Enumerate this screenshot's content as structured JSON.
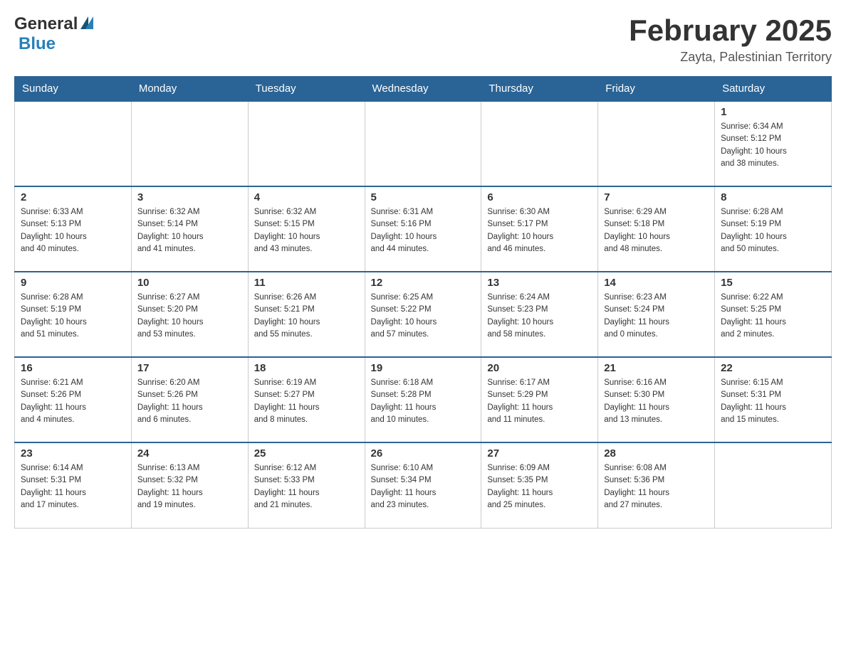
{
  "header": {
    "logo_general": "General",
    "logo_blue": "Blue",
    "month_year": "February 2025",
    "location": "Zayta, Palestinian Territory"
  },
  "days_of_week": [
    "Sunday",
    "Monday",
    "Tuesday",
    "Wednesday",
    "Thursday",
    "Friday",
    "Saturday"
  ],
  "weeks": [
    {
      "days": [
        {
          "number": "",
          "info": ""
        },
        {
          "number": "",
          "info": ""
        },
        {
          "number": "",
          "info": ""
        },
        {
          "number": "",
          "info": ""
        },
        {
          "number": "",
          "info": ""
        },
        {
          "number": "",
          "info": ""
        },
        {
          "number": "1",
          "info": "Sunrise: 6:34 AM\nSunset: 5:12 PM\nDaylight: 10 hours\nand 38 minutes."
        }
      ]
    },
    {
      "days": [
        {
          "number": "2",
          "info": "Sunrise: 6:33 AM\nSunset: 5:13 PM\nDaylight: 10 hours\nand 40 minutes."
        },
        {
          "number": "3",
          "info": "Sunrise: 6:32 AM\nSunset: 5:14 PM\nDaylight: 10 hours\nand 41 minutes."
        },
        {
          "number": "4",
          "info": "Sunrise: 6:32 AM\nSunset: 5:15 PM\nDaylight: 10 hours\nand 43 minutes."
        },
        {
          "number": "5",
          "info": "Sunrise: 6:31 AM\nSunset: 5:16 PM\nDaylight: 10 hours\nand 44 minutes."
        },
        {
          "number": "6",
          "info": "Sunrise: 6:30 AM\nSunset: 5:17 PM\nDaylight: 10 hours\nand 46 minutes."
        },
        {
          "number": "7",
          "info": "Sunrise: 6:29 AM\nSunset: 5:18 PM\nDaylight: 10 hours\nand 48 minutes."
        },
        {
          "number": "8",
          "info": "Sunrise: 6:28 AM\nSunset: 5:19 PM\nDaylight: 10 hours\nand 50 minutes."
        }
      ]
    },
    {
      "days": [
        {
          "number": "9",
          "info": "Sunrise: 6:28 AM\nSunset: 5:19 PM\nDaylight: 10 hours\nand 51 minutes."
        },
        {
          "number": "10",
          "info": "Sunrise: 6:27 AM\nSunset: 5:20 PM\nDaylight: 10 hours\nand 53 minutes."
        },
        {
          "number": "11",
          "info": "Sunrise: 6:26 AM\nSunset: 5:21 PM\nDaylight: 10 hours\nand 55 minutes."
        },
        {
          "number": "12",
          "info": "Sunrise: 6:25 AM\nSunset: 5:22 PM\nDaylight: 10 hours\nand 57 minutes."
        },
        {
          "number": "13",
          "info": "Sunrise: 6:24 AM\nSunset: 5:23 PM\nDaylight: 10 hours\nand 58 minutes."
        },
        {
          "number": "14",
          "info": "Sunrise: 6:23 AM\nSunset: 5:24 PM\nDaylight: 11 hours\nand 0 minutes."
        },
        {
          "number": "15",
          "info": "Sunrise: 6:22 AM\nSunset: 5:25 PM\nDaylight: 11 hours\nand 2 minutes."
        }
      ]
    },
    {
      "days": [
        {
          "number": "16",
          "info": "Sunrise: 6:21 AM\nSunset: 5:26 PM\nDaylight: 11 hours\nand 4 minutes."
        },
        {
          "number": "17",
          "info": "Sunrise: 6:20 AM\nSunset: 5:26 PM\nDaylight: 11 hours\nand 6 minutes."
        },
        {
          "number": "18",
          "info": "Sunrise: 6:19 AM\nSunset: 5:27 PM\nDaylight: 11 hours\nand 8 minutes."
        },
        {
          "number": "19",
          "info": "Sunrise: 6:18 AM\nSunset: 5:28 PM\nDaylight: 11 hours\nand 10 minutes."
        },
        {
          "number": "20",
          "info": "Sunrise: 6:17 AM\nSunset: 5:29 PM\nDaylight: 11 hours\nand 11 minutes."
        },
        {
          "number": "21",
          "info": "Sunrise: 6:16 AM\nSunset: 5:30 PM\nDaylight: 11 hours\nand 13 minutes."
        },
        {
          "number": "22",
          "info": "Sunrise: 6:15 AM\nSunset: 5:31 PM\nDaylight: 11 hours\nand 15 minutes."
        }
      ]
    },
    {
      "days": [
        {
          "number": "23",
          "info": "Sunrise: 6:14 AM\nSunset: 5:31 PM\nDaylight: 11 hours\nand 17 minutes."
        },
        {
          "number": "24",
          "info": "Sunrise: 6:13 AM\nSunset: 5:32 PM\nDaylight: 11 hours\nand 19 minutes."
        },
        {
          "number": "25",
          "info": "Sunrise: 6:12 AM\nSunset: 5:33 PM\nDaylight: 11 hours\nand 21 minutes."
        },
        {
          "number": "26",
          "info": "Sunrise: 6:10 AM\nSunset: 5:34 PM\nDaylight: 11 hours\nand 23 minutes."
        },
        {
          "number": "27",
          "info": "Sunrise: 6:09 AM\nSunset: 5:35 PM\nDaylight: 11 hours\nand 25 minutes."
        },
        {
          "number": "28",
          "info": "Sunrise: 6:08 AM\nSunset: 5:36 PM\nDaylight: 11 hours\nand 27 minutes."
        },
        {
          "number": "",
          "info": ""
        }
      ]
    }
  ]
}
